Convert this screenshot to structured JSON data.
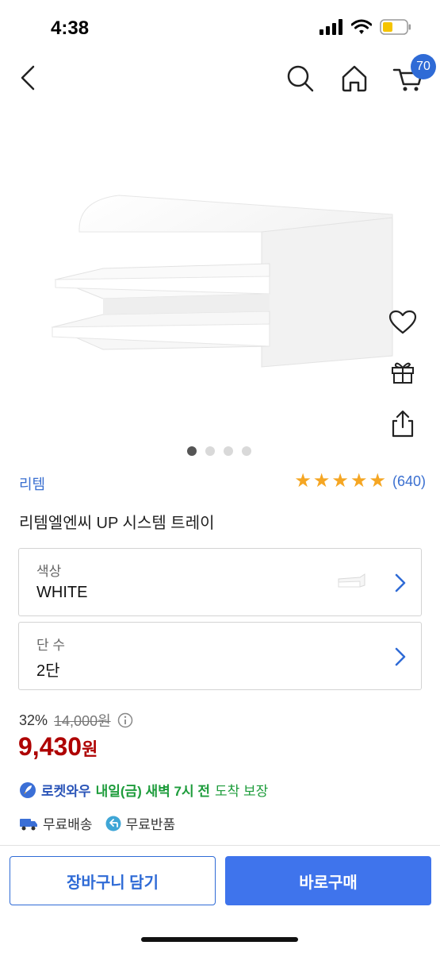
{
  "status": {
    "time": "4:38"
  },
  "nav": {
    "back_icon": "chevron-left-icon",
    "search_icon": "search-icon",
    "home_icon": "home-icon",
    "cart_icon": "cart-icon",
    "cart_count": "70"
  },
  "gallery": {
    "page_count": 4,
    "active_page": 1
  },
  "side_actions": [
    "heart-icon",
    "gift-icon",
    "share-icon"
  ],
  "product": {
    "brand": "리템",
    "rating_stars": 5,
    "review_count": "(640)",
    "title": "리템엘엔씨 UP 시스템 트레이"
  },
  "options": [
    {
      "label": "색상",
      "value": "WHITE",
      "has_thumbnail": true
    },
    {
      "label": "단 수",
      "value": "2단",
      "has_thumbnail": false
    }
  ],
  "pricing": {
    "discount": "32%",
    "original_price": "14,000원",
    "price": "9,430",
    "price_unit": "원"
  },
  "delivery": {
    "rocket_label": "로켓와우",
    "eta_strong": "내일(금) 새벽 7시 전",
    "eta_normal": "도착 보장"
  },
  "benefits": [
    {
      "icon": "truck-icon",
      "label": "무료배송"
    },
    {
      "icon": "return-icon",
      "label": "무료반품"
    }
  ],
  "actions": {
    "add_to_cart": "장바구니 담기",
    "buy_now": "바로구매"
  },
  "colors": {
    "accent": "#3f74ec",
    "price": "#ae0000",
    "star": "#f5a623",
    "delivery": "#1d9c3b"
  }
}
